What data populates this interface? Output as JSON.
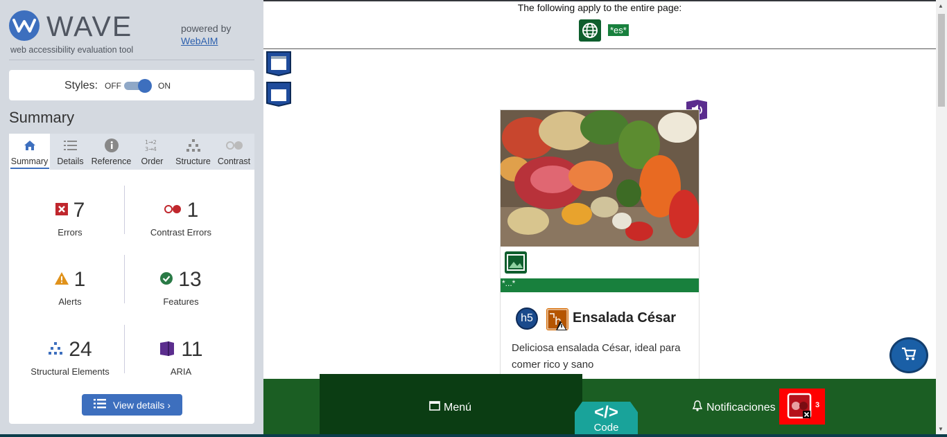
{
  "wave": {
    "title": "WAVE",
    "subtitle": "web accessibility evaluation tool",
    "powered_by": "powered by",
    "powered_link": "WebAIM",
    "styles_label": "Styles:",
    "styles_off": "OFF",
    "styles_on": "ON",
    "summary_heading": "Summary",
    "tabs": [
      {
        "label": "Summary",
        "icon": "home-icon"
      },
      {
        "label": "Details",
        "icon": "list-icon"
      },
      {
        "label": "Reference",
        "icon": "info-icon"
      },
      {
        "label": "Order",
        "icon": "order-icon"
      },
      {
        "label": "Structure",
        "icon": "structure-icon"
      },
      {
        "label": "Contrast",
        "icon": "contrast-icon"
      }
    ],
    "stats": {
      "errors": {
        "value": "7",
        "label": "Errors"
      },
      "contrast": {
        "value": "1",
        "label": "Contrast Errors"
      },
      "alerts": {
        "value": "1",
        "label": "Alerts"
      },
      "features": {
        "value": "13",
        "label": "Features"
      },
      "structure": {
        "value": "24",
        "label": "Structural Elements"
      },
      "aria": {
        "value": "11",
        "label": "ARIA"
      }
    },
    "view_details": "View details ›"
  },
  "page": {
    "apply_text": "The following apply to the entire page:",
    "lang_badge": "*es*",
    "alt_badge": "*...*",
    "card_title": "Ensalada César",
    "card_desc": "Deliciosa ensalada César, ideal para comer rico y sano",
    "h5_label": "h5",
    "menu_label": "Menú",
    "notif_label": "Notificaciones",
    "contrast_count": "3",
    "code_symbol": "</>",
    "code_label": "Code"
  },
  "colors": {
    "wave_blue": "#3d6fbe",
    "error_red": "#c0272d",
    "alert_orange": "#e0921b",
    "feature_green": "#2a7a46",
    "aria_purple": "#5b2d8e",
    "page_green": "#1b5e23"
  }
}
